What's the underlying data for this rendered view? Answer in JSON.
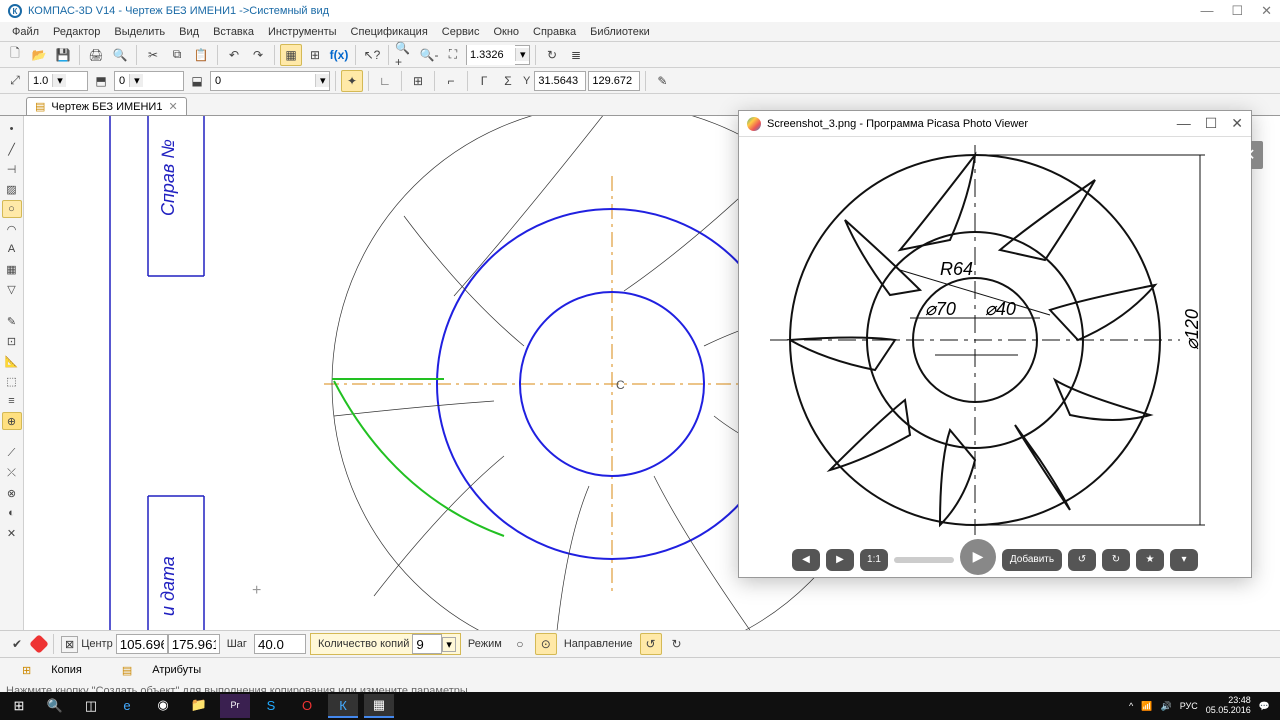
{
  "title": "КОМПАС-3D V14 - Чертеж БЕЗ ИМЕНИ1 ->Системный вид",
  "menus": [
    "Файл",
    "Редактор",
    "Выделить",
    "Вид",
    "Вставка",
    "Инструменты",
    "Спецификация",
    "Сервис",
    "Окно",
    "Справка",
    "Библиотеки"
  ],
  "toolbar2": {
    "step": "1.0",
    "layer": "0",
    "color": "0",
    "zoom": "1.3326",
    "coordX": "31.5643",
    "coordY": "129.672"
  },
  "tab": "Чертеж БЕЗ ИМЕНИ1",
  "params": {
    "center_label": "Центр",
    "cx": "105.696",
    "cy": "175.961",
    "step_label": "Шаг",
    "step": "40.0",
    "count_label": "Количество копий",
    "count": "9",
    "mode_label": "Режим",
    "dir_label": "Направление"
  },
  "bottom_tabs": {
    "copy": "Копия",
    "attrs": "Атрибуты"
  },
  "status": "Нажмите кнопку \"Создать объект\" для выполнения копирования или измените параметры",
  "picasa": {
    "title": "Screenshot_3.png - Программа Picasa Photo Viewer",
    "labels": {
      "r": "R64",
      "d70": "⌀70",
      "d40": "⌀40",
      "d120": "⌀120"
    },
    "add": "Добавить",
    "ratio": "1:1"
  },
  "tray": {
    "lang": "РУС",
    "time": "23:48",
    "date": "05.05.2016"
  }
}
